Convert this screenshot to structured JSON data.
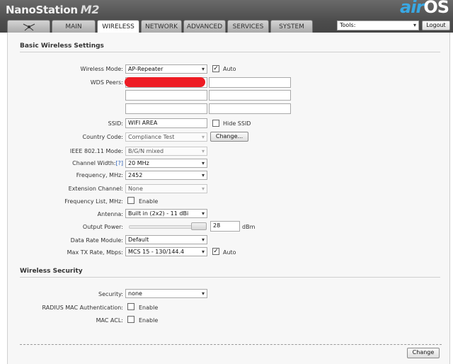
{
  "header": {
    "device_name": "NanoStation",
    "device_model": "M2",
    "brand_air": "air",
    "brand_os": "OS"
  },
  "tabs": [
    {
      "id": "logo",
      "label": ""
    },
    {
      "id": "main",
      "label": "MAIN"
    },
    {
      "id": "wireless",
      "label": "WIRELESS"
    },
    {
      "id": "network",
      "label": "NETWORK"
    },
    {
      "id": "advanced",
      "label": "ADVANCED"
    },
    {
      "id": "services",
      "label": "SERVICES"
    },
    {
      "id": "system",
      "label": "SYSTEM"
    }
  ],
  "active_tab": "wireless",
  "tools": {
    "selected": "Tools:",
    "logout_label": "Logout"
  },
  "basic": {
    "title": "Basic Wireless Settings",
    "wireless_mode": {
      "label": "Wireless Mode:",
      "value": "AP-Repeater",
      "auto_label": "Auto",
      "auto_checked": true
    },
    "wds_peers": {
      "label": "WDS Peers:",
      "values": [
        "",
        "",
        "",
        "",
        "",
        ""
      ]
    },
    "ssid": {
      "label": "SSID:",
      "value": "WIFI AREA",
      "hide_label": "Hide SSID",
      "hide_checked": false
    },
    "country_code": {
      "label": "Country Code:",
      "value": "Compliance Test",
      "button": "Change..."
    },
    "ieee_mode": {
      "label": "IEEE 802.11 Mode:",
      "value": "B/G/N mixed"
    },
    "channel_width": {
      "label": "Channel Width:",
      "help": "[?]",
      "value": "20 MHz"
    },
    "frequency": {
      "label": "Frequency, MHz:",
      "value": "2452"
    },
    "extension_channel": {
      "label": "Extension Channel:",
      "value": "None"
    },
    "frequency_list": {
      "label": "Frequency List, MHz:",
      "enable_label": "Enable",
      "checked": false
    },
    "antenna": {
      "label": "Antenna:",
      "value": "Built in (2x2) - 11 dBi"
    },
    "output_power": {
      "label": "Output Power:",
      "value": "28",
      "unit": "dBm",
      "slider_fraction": 0.93
    },
    "data_rate_module": {
      "label": "Data Rate Module:",
      "value": "Default"
    },
    "max_tx_rate": {
      "label": "Max TX Rate, Mbps:",
      "value": "MCS 15 - 130/144.4",
      "auto_label": "Auto",
      "auto_checked": true
    }
  },
  "security": {
    "title": "Wireless Security",
    "security": {
      "label": "Security:",
      "value": "none"
    },
    "radius_mac": {
      "label": "RADIUS MAC Authentication:",
      "enable_label": "Enable",
      "checked": false
    },
    "mac_acl": {
      "label": "MAC ACL:",
      "enable_label": "Enable",
      "checked": false
    }
  },
  "footer": {
    "change_label": "Change"
  },
  "colors": {
    "accent": "#39a8e4",
    "redaction": "#ee1c24",
    "header": "#555555"
  }
}
